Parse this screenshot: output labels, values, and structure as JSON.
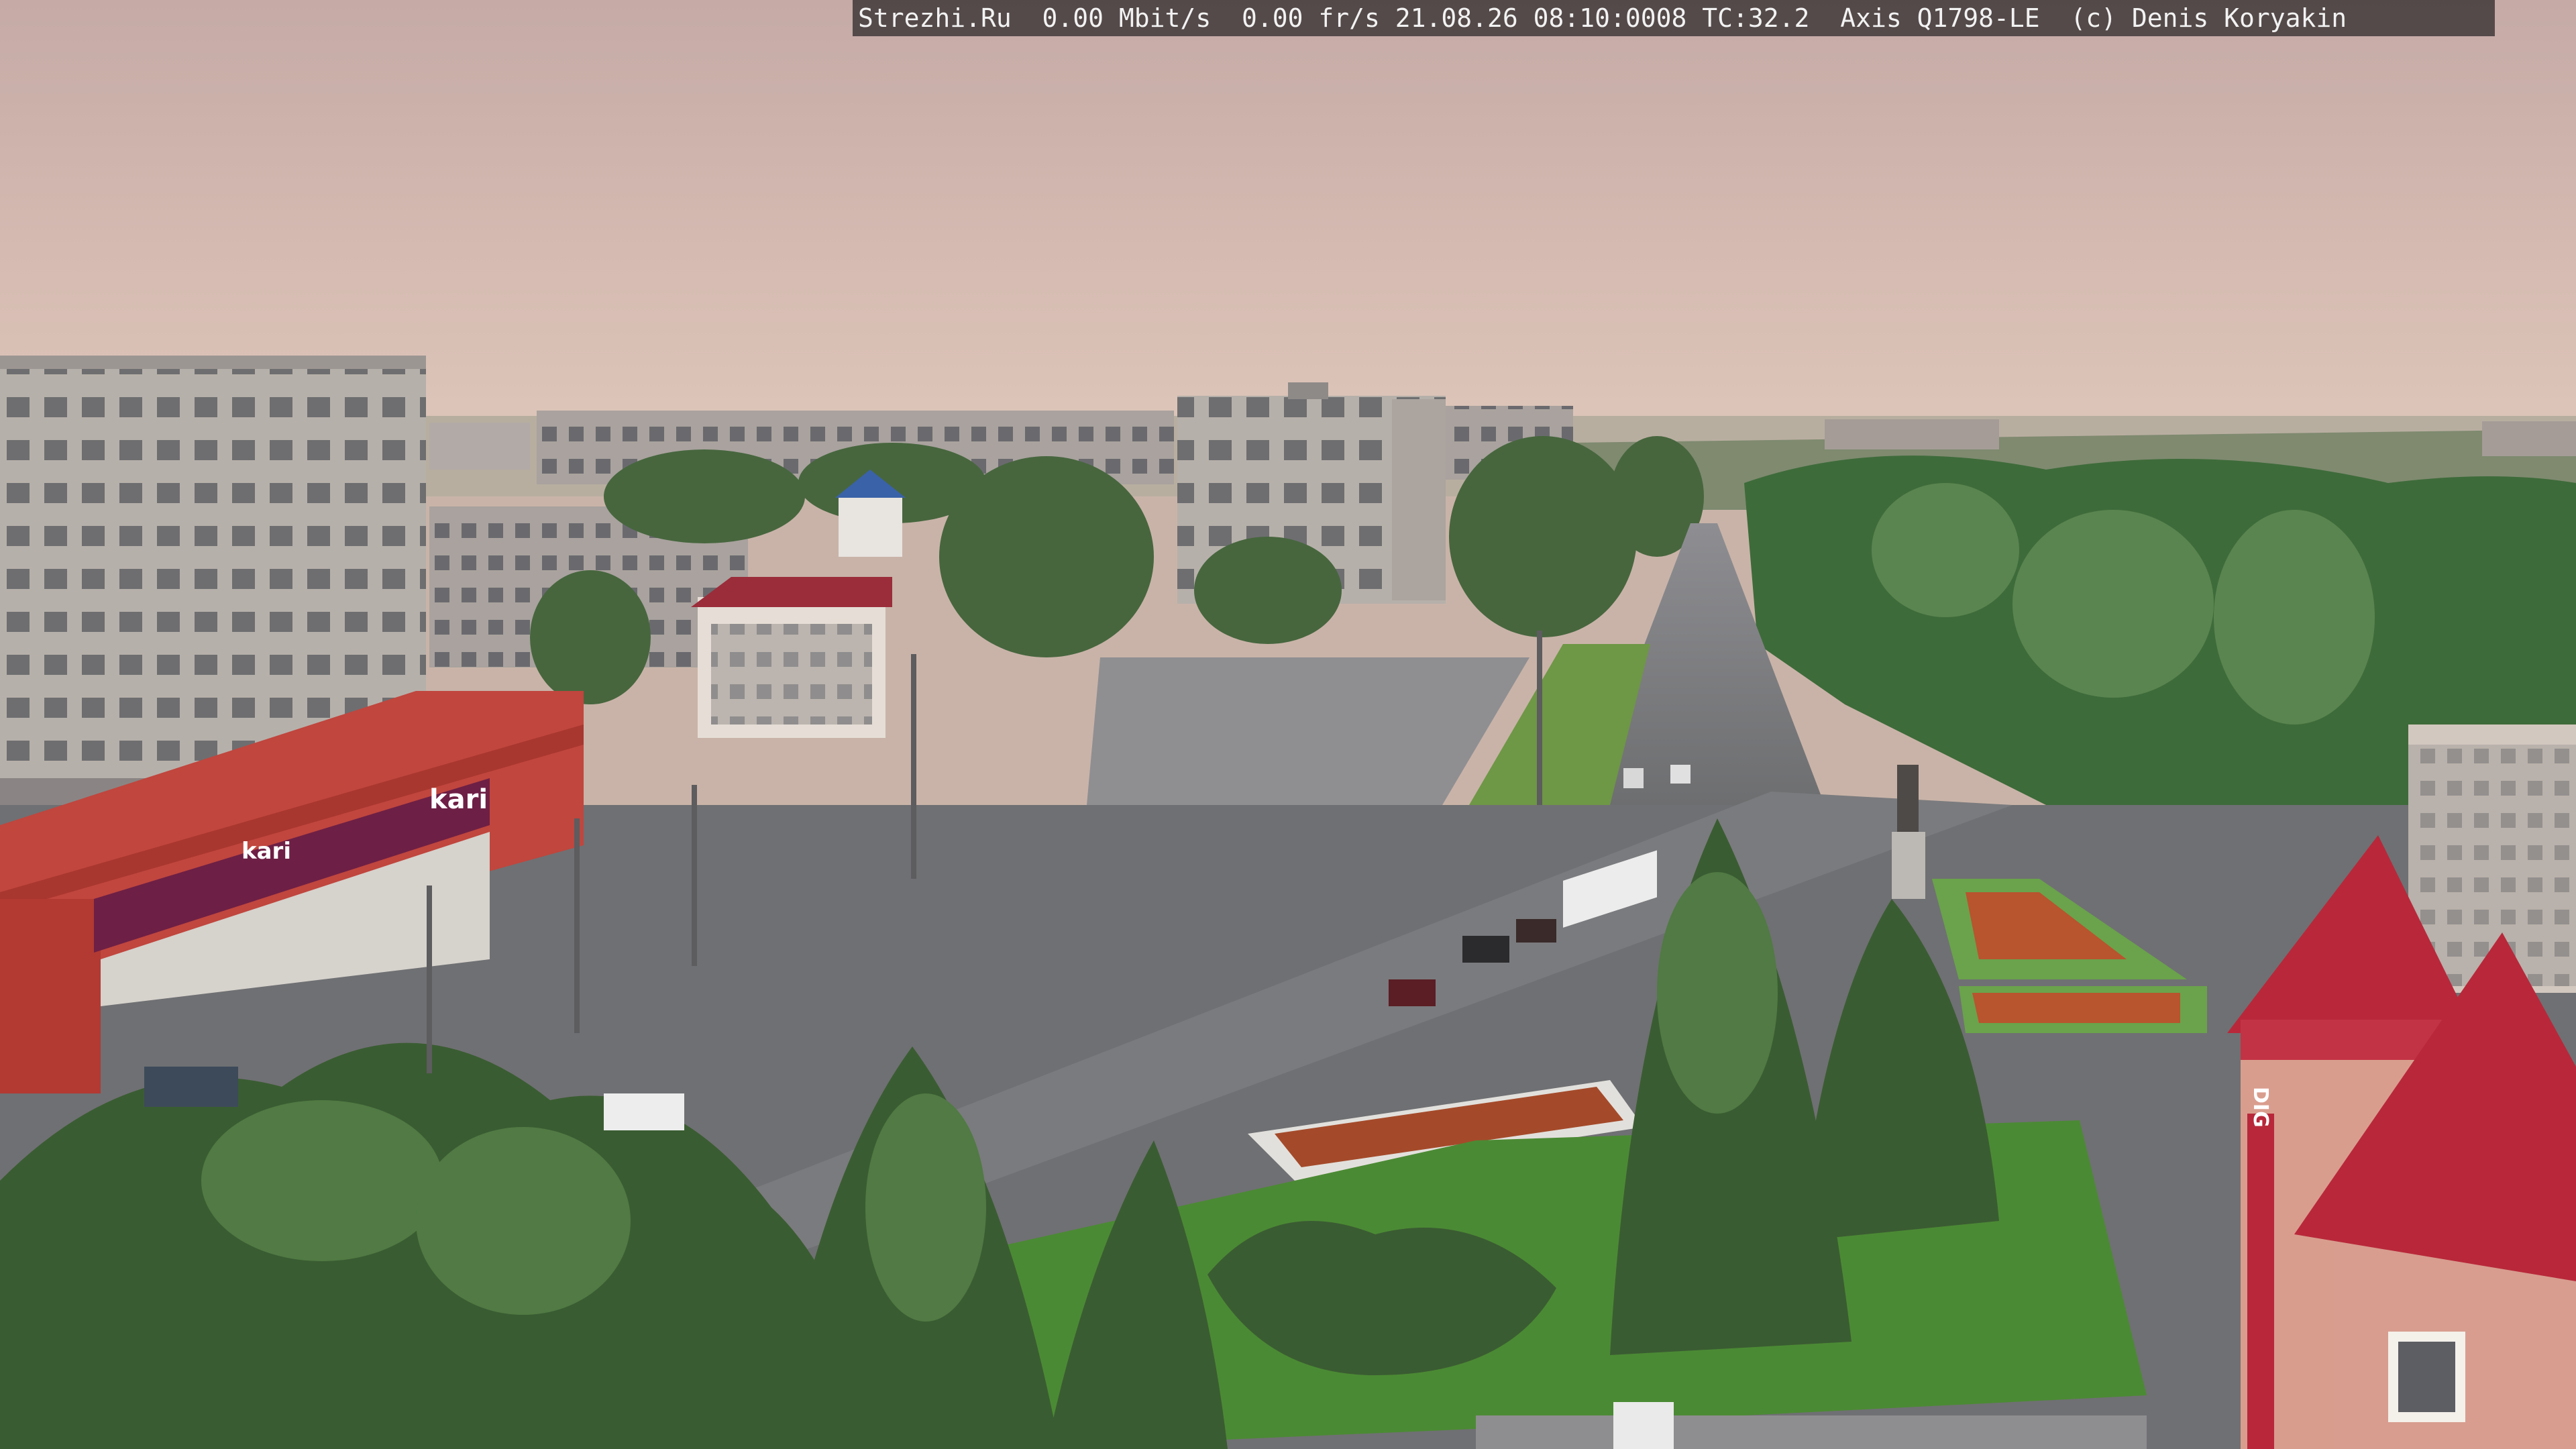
{
  "camera_overlay": {
    "text": "Strezhi.Ru  0.00 Mbit/s  0.00 fr/s 21.08.26 08:10:0008 TC:32.2  Axis Q1798-LE  (c) Denis Koryakin"
  },
  "signs": {
    "store_brand": "kari",
    "store_brand_2": "kari",
    "right_building_vertical": "DIG"
  },
  "colors": {
    "sky_top": "#c8aca5",
    "sky_horizon": "#dcc3b5",
    "foliage": "#3f6b3c",
    "road": "#77787a",
    "store_red": "#c0463e",
    "roof_red": "#b8283a"
  }
}
